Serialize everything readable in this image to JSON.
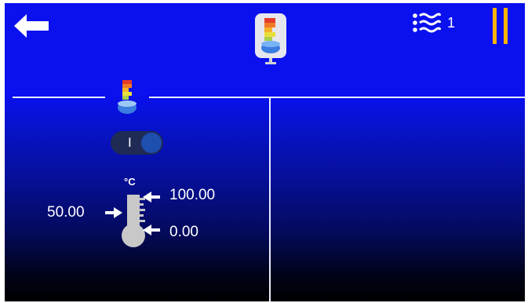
{
  "header": {
    "back_icon": "arrow-left-icon",
    "device_icon": "water-heater-icon",
    "fan_icon": "fan-speed-icon",
    "fan_level": "1",
    "pause_icon": "pause-icon",
    "pause_color": "#ffb400"
  },
  "panel": {
    "section_icon": "water-heater-icon",
    "toggle_label": "I",
    "temperature": {
      "unit": "°C",
      "setpoint": "50.00",
      "max": "100.00",
      "min": "0.00"
    }
  }
}
